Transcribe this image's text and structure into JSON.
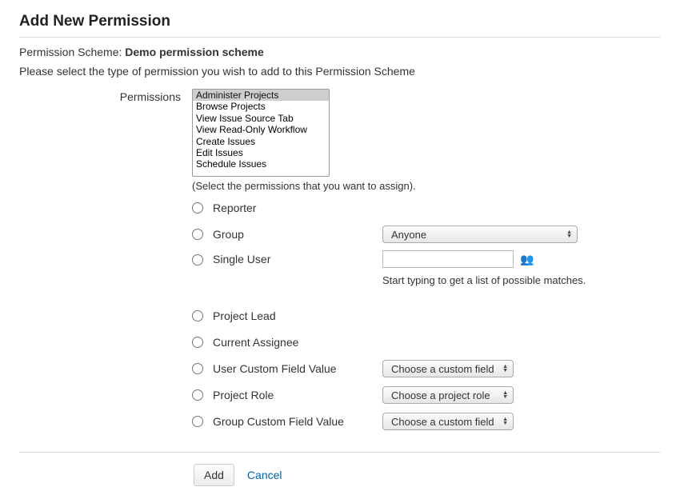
{
  "page_title": "Add New Permission",
  "scheme_prefix": "Permission Scheme: ",
  "scheme_name": "Demo permission scheme",
  "instruction": "Please select the type of permission you wish to add to this Permission Scheme",
  "permissions_label": "Permissions",
  "permissions_options": [
    "Administer Projects",
    "Browse Projects",
    "View Issue Source Tab",
    "View Read-Only Workflow",
    "Create Issues",
    "Edit Issues",
    "Schedule Issues"
  ],
  "permissions_hint": "(Select the permissions that you want to assign).",
  "radios": {
    "reporter": "Reporter",
    "group": "Group",
    "single_user": "Single User",
    "project_lead": "Project Lead",
    "current_assignee": "Current Assignee",
    "user_cf": "User Custom Field Value",
    "project_role": "Project Role",
    "group_cf": "Group Custom Field Value"
  },
  "group_select": "Anyone",
  "single_user_hint": "Start typing to get a list of possible matches.",
  "user_cf_select": "Choose a custom field",
  "project_role_select": "Choose a project role",
  "group_cf_select": "Choose a custom field",
  "buttons": {
    "add": "Add",
    "cancel": "Cancel"
  }
}
